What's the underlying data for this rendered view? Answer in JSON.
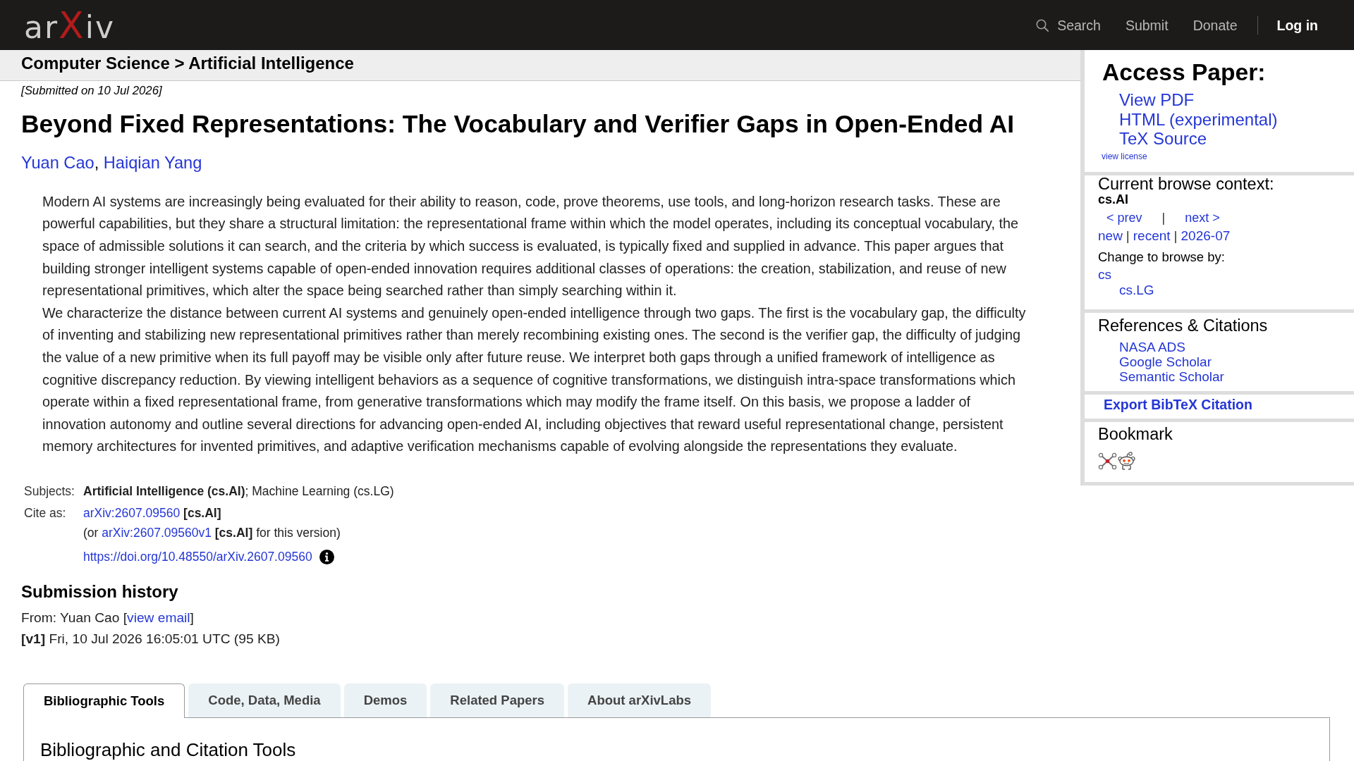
{
  "header": {
    "logo": "arXiv",
    "nav": [
      {
        "kind": "search",
        "label": "Search"
      },
      {
        "kind": "link",
        "label": "Submit"
      },
      {
        "kind": "link",
        "label": "Donate"
      },
      {
        "kind": "account",
        "label": "Log in"
      }
    ]
  },
  "breadcrumb": "Computer Science > Artificial Intelligence",
  "paper": {
    "submitted": "[Submitted on 10 Jul 2026]",
    "title": "Beyond Fixed Representations: The Vocabulary and Verifier Gaps in Open-Ended AI",
    "authors": [
      {
        "name": "Yuan Cao",
        "separator": ","
      },
      {
        "name": "Haiqian Yang"
      }
    ],
    "abstract": [
      "Modern AI systems are increasingly being evaluated for their ability to reason, code, prove theorems, use tools, and long-horizon research tasks. These are powerful capabilities, but they share a structural limitation: the representational frame within which the model operates, including its conceptual vocabulary, the space of admissible solutions it can search, and the criteria by which success is evaluated, is typically fixed and supplied in advance. This paper argues that building stronger intelligent systems capable of open-ended innovation requires additional classes of operations: the creation, stabilization, and reuse of new representational primitives, which alter the space being searched rather than simply searching within it.",
      "We characterize the distance between current AI systems and genuinely open-ended intelligence through two gaps. The first is the vocabulary gap, the difficulty of inventing and stabilizing new representational primitives rather than merely recombining existing ones. The second is the verifier gap, the difficulty of judging the value of a new primitive when its full payoff may be visible only after future reuse. We interpret both gaps through a unified framework of intelligence as cognitive discrepancy reduction. By viewing intelligent behaviors as a sequence of cognitive transformations, we distinguish intra-space transformations which operate within a fixed representational frame, from generative transformations which may modify the frame itself. On this basis, we propose a ladder of innovation autonomy and outline several directions for advancing open-ended AI, including objectives that reward useful representational change, persistent memory architectures for invented primitives, and adaptive verification mechanisms capable of evolving alongside the representations they evaluate."
    ]
  },
  "metadata": {
    "subjects": {
      "label": "Subjects:",
      "value": "**Artificial Intelligence (cs.AI)**; Machine Learning (cs.LG)"
    },
    "cite_as": {
      "label": "Cite as:",
      "id": "arXiv:2607.09560",
      "category": "[cs.AI]",
      "version_prefix": "(or",
      "version_id": "arXiv:2607.09560v1",
      "version_category": "[cs.AI]",
      "version_suffix": "for this version)",
      "doi": "https://doi.org/10.48550/arXiv.2607.09560"
    }
  },
  "submission_history": {
    "heading": "Submission history",
    "from_prefix": "From: Yuan Cao [",
    "from_link": "view email",
    "from_suffix": "]",
    "versions": [
      "**[v1]** Fri, 10 Jul 2026 16:05:01 UTC (95 KB)"
    ]
  },
  "sidebar": {
    "access": {
      "heading": "Access Paper:",
      "links": [
        "View PDF",
        "HTML (experimental)",
        "TeX Source"
      ],
      "license": "view license"
    },
    "browse": {
      "heading": "Current browse context:",
      "context": "cs.AI",
      "pager": [
        {
          "kind": "link",
          "text": "< prev"
        },
        {
          "kind": "separator",
          "text": "|"
        },
        {
          "kind": "link",
          "text": "next >"
        }
      ],
      "listing": [
        {
          "kind": "link",
          "text": "new"
        },
        {
          "kind": "separator",
          "text": "|"
        },
        {
          "kind": "link",
          "text": "recent"
        },
        {
          "kind": "separator",
          "text": "|"
        },
        {
          "kind": "link",
          "text": "2026-07"
        }
      ],
      "change_label": "Change to browse by:",
      "categories": [
        {
          "label": "cs",
          "children": [
            {
              "label": "cs.LG"
            }
          ]
        }
      ]
    },
    "references": {
      "heading": "References & Citations",
      "links": [
        "NASA ADS",
        "Google Scholar",
        "Semantic Scholar"
      ]
    },
    "export": "Export BibTeX Citation",
    "bookmark": {
      "heading": "Bookmark"
    }
  },
  "tabs": [
    {
      "label": "Bibliographic Tools",
      "selected": true
    },
    {
      "label": "Code, Data, Media",
      "selected": false
    },
    {
      "label": "Demos",
      "selected": false
    },
    {
      "label": "Related Papers",
      "selected": false
    },
    {
      "label": "About arXivLabs",
      "selected": false
    }
  ],
  "tab_panel": {
    "heading": "Bibliographic and Citation Tools"
  }
}
